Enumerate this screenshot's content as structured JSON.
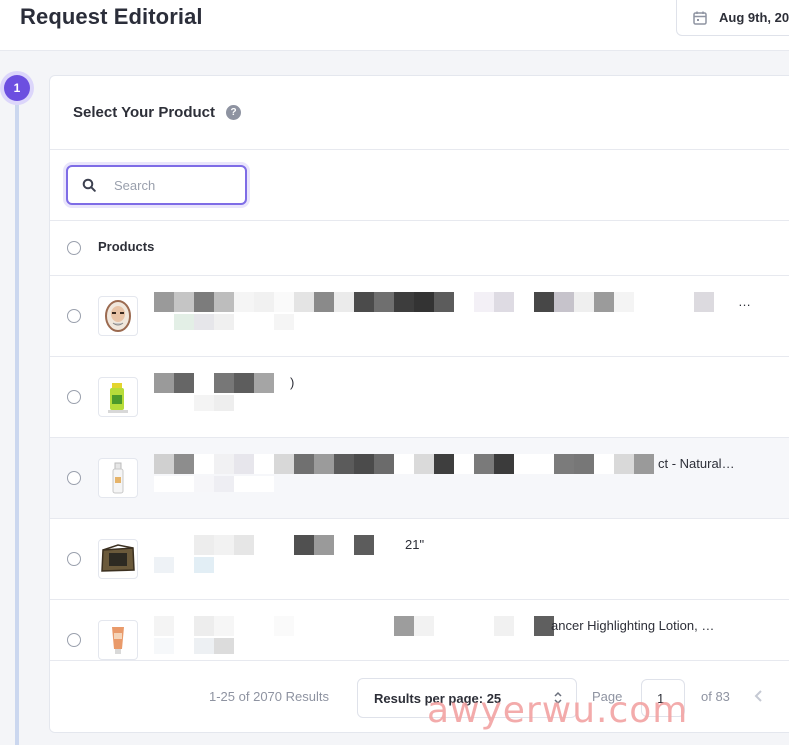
{
  "header": {
    "title": "Request Editorial",
    "date_label": "Aug 9th, 20"
  },
  "step": {
    "number": "1"
  },
  "card": {
    "title": "Select Your Product",
    "help_icon_glyph": "?"
  },
  "search": {
    "placeholder": "Search",
    "value": ""
  },
  "table": {
    "column_header": "Products",
    "rows": [
      {
        "title": "…",
        "thumb": "face-mask-icon"
      },
      {
        "title": ")",
        "thumb": "green-bottle-icon"
      },
      {
        "title": "ct - Natural…",
        "thumb": "spray-bottle-icon"
      },
      {
        "title": "21\"",
        "thumb": "pet-crate-icon"
      },
      {
        "title": "ancer Highlighting Lotion, …",
        "thumb": "lotion-tube-icon"
      }
    ]
  },
  "pagination": {
    "results_text": "1-25 of 2070 Results",
    "per_page_label": "Results per page: 25",
    "page_label": "Page",
    "page_value": "1",
    "of_label": "of 83"
  },
  "watermark": "awyerwu.com",
  "colors": {
    "accent": "#6c4fe0",
    "accent_light": "#dcd6fb",
    "step_line": "#cbd7ef",
    "text": "#2d2f38",
    "muted": "#8e93a1",
    "border": "#e7e9ef",
    "watermark": "#f2a3a3"
  }
}
